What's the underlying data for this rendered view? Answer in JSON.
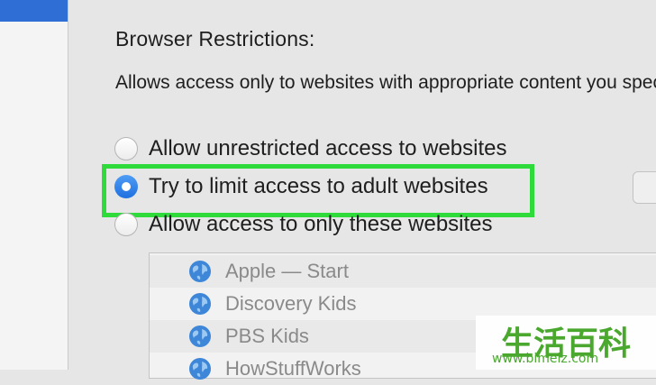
{
  "section": {
    "title": "Browser Restrictions:",
    "description": "Allows access only to websites with appropriate content you specify."
  },
  "options": [
    {
      "label": "Allow unrestricted access to websites",
      "selected": false
    },
    {
      "label": "Try to limit access to adult websites",
      "selected": true
    },
    {
      "label": "Allow access to only these websites",
      "selected": false
    }
  ],
  "sites": [
    "Apple — Start",
    "Discovery Kids",
    "PBS Kids",
    "HowStuffWorks"
  ],
  "watermark": {
    "chars": "生活百科",
    "url": "www.bimeiz.com"
  },
  "colors": {
    "accent": "#2f6ed4",
    "highlight": "#2fdb3a",
    "watermark": "#4aa82e"
  },
  "icons": {
    "site": "globe-icon"
  }
}
